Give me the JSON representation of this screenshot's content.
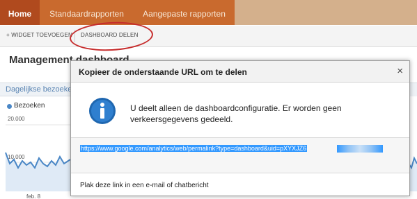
{
  "nav": {
    "home": "Home",
    "standard_reports": "Standaardrapporten",
    "custom_reports": "Aangepaste rapporten"
  },
  "toolbar": {
    "add_widget": "+ WIDGET TOEVOEGEN",
    "share_dashboard": "DASHBOARD DELEN"
  },
  "dashboard": {
    "title": "Management dashboard",
    "widget_title": "Dagelijkse bezoeken",
    "legend_label": "Bezoeken",
    "y_top": "20.000",
    "y_mid": "10.000",
    "x_tick": "feb. 8"
  },
  "modal": {
    "title": "Kopieer de onderstaande URL om te delen",
    "close_symbol": "×",
    "message": "U deelt alleen de dashboardconfiguratie. Er worden geen verkeersgegevens gedeeld.",
    "url": "https://www.google.com/analytics/web/permalink?type=dashboard&uid=pXYXJZ6",
    "footer": "Plak deze link in een e-mail of chatbericht"
  },
  "colors": {
    "highlight_circle": "#c62b2b",
    "url_selection": "#3399ff",
    "info_icon": "#1f67b0"
  },
  "icons": {
    "info": "info-icon",
    "close": "close-icon"
  }
}
